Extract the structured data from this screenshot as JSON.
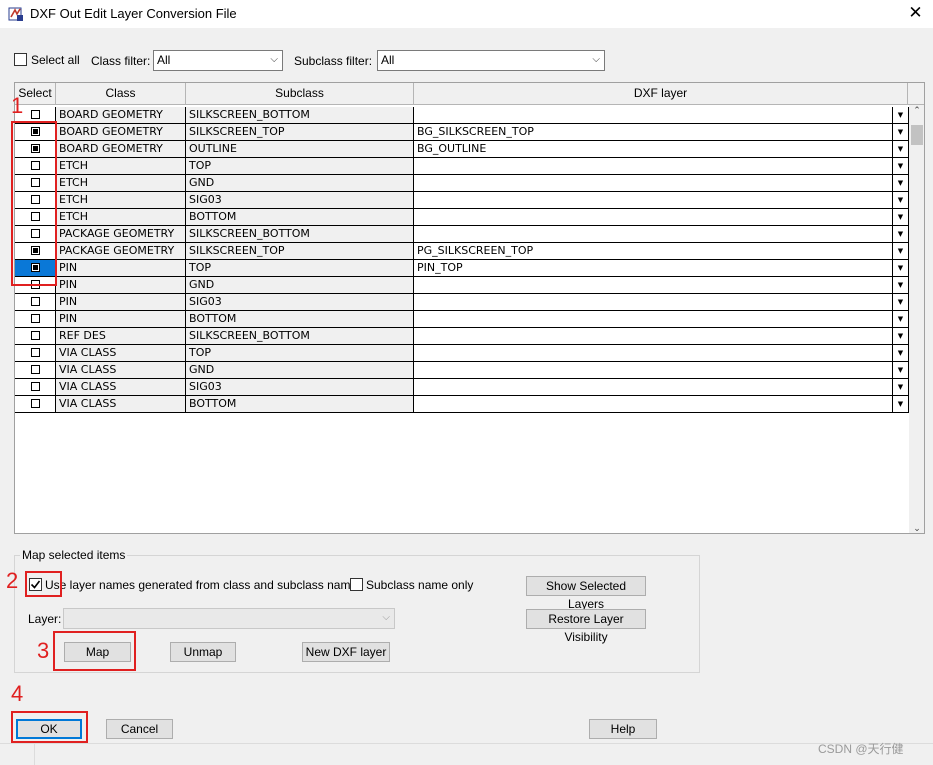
{
  "window": {
    "title": "DXF Out Edit Layer Conversion File",
    "close_glyph": "✕",
    "icon": "dxf-app-icon"
  },
  "filters": {
    "select_all_label": "Select all",
    "select_all_checked": false,
    "class_filter_label": "Class filter:",
    "class_filter_value": "All",
    "subclass_filter_label": "Subclass filter:",
    "subclass_filter_value": "All"
  },
  "table": {
    "columns": [
      "Select",
      "Class",
      "Subclass",
      "DXF layer"
    ],
    "rows": [
      {
        "selected": false,
        "class": "BOARD GEOMETRY",
        "subclass": "SILKSCREEN_BOTTOM",
        "dxf_layer": ""
      },
      {
        "selected": true,
        "class": "BOARD GEOMETRY",
        "subclass": "SILKSCREEN_TOP",
        "dxf_layer": "BG_SILKSCREEN_TOP"
      },
      {
        "selected": true,
        "class": "BOARD GEOMETRY",
        "subclass": "OUTLINE",
        "dxf_layer": "BG_OUTLINE"
      },
      {
        "selected": false,
        "class": "ETCH",
        "subclass": "TOP",
        "dxf_layer": ""
      },
      {
        "selected": false,
        "class": "ETCH",
        "subclass": "GND",
        "dxf_layer": ""
      },
      {
        "selected": false,
        "class": "ETCH",
        "subclass": "SIG03",
        "dxf_layer": ""
      },
      {
        "selected": false,
        "class": "ETCH",
        "subclass": "BOTTOM",
        "dxf_layer": ""
      },
      {
        "selected": false,
        "class": "PACKAGE GEOMETRY",
        "subclass": "SILKSCREEN_BOTTOM",
        "dxf_layer": ""
      },
      {
        "selected": true,
        "class": "PACKAGE GEOMETRY",
        "subclass": "SILKSCREEN_TOP",
        "dxf_layer": "PG_SILKSCREEN_TOP"
      },
      {
        "selected": true,
        "class": "PIN",
        "subclass": "TOP",
        "dxf_layer": "PIN_TOP",
        "active": true
      },
      {
        "selected": false,
        "class": "PIN",
        "subclass": "GND",
        "dxf_layer": ""
      },
      {
        "selected": false,
        "class": "PIN",
        "subclass": "SIG03",
        "dxf_layer": ""
      },
      {
        "selected": false,
        "class": "PIN",
        "subclass": "BOTTOM",
        "dxf_layer": ""
      },
      {
        "selected": false,
        "class": "REF DES",
        "subclass": "SILKSCREEN_BOTTOM",
        "dxf_layer": ""
      },
      {
        "selected": false,
        "class": "VIA CLASS",
        "subclass": "TOP",
        "dxf_layer": ""
      },
      {
        "selected": false,
        "class": "VIA CLASS",
        "subclass": "GND",
        "dxf_layer": ""
      },
      {
        "selected": false,
        "class": "VIA CLASS",
        "subclass": "SIG03",
        "dxf_layer": ""
      },
      {
        "selected": false,
        "class": "VIA CLASS",
        "subclass": "BOTTOM",
        "dxf_layer": ""
      }
    ]
  },
  "map_group": {
    "title": "Map selected items",
    "use_layer_names_label": "Use layer names generated from class and subclass names",
    "use_layer_names_checked": true,
    "subclass_only_label": "Subclass name only",
    "subclass_only_checked": false,
    "layer_label": "Layer:",
    "layer_value": "",
    "map_button": "Map",
    "unmap_button": "Unmap",
    "new_dxf_layer_button": "New DXF layer",
    "show_selected_button": "Show Selected Layers",
    "restore_visibility_button": "Restore Layer Visibility"
  },
  "footer": {
    "ok_button": "OK",
    "cancel_button": "Cancel",
    "help_button": "Help"
  },
  "annotations": {
    "color": "#e02020",
    "labels": [
      "1",
      "2",
      "3",
      "4"
    ]
  },
  "watermark": "CSDN @天行健",
  "colors": {
    "selection_blue": "#0a78d7",
    "default_button_border": "#0078d7"
  }
}
